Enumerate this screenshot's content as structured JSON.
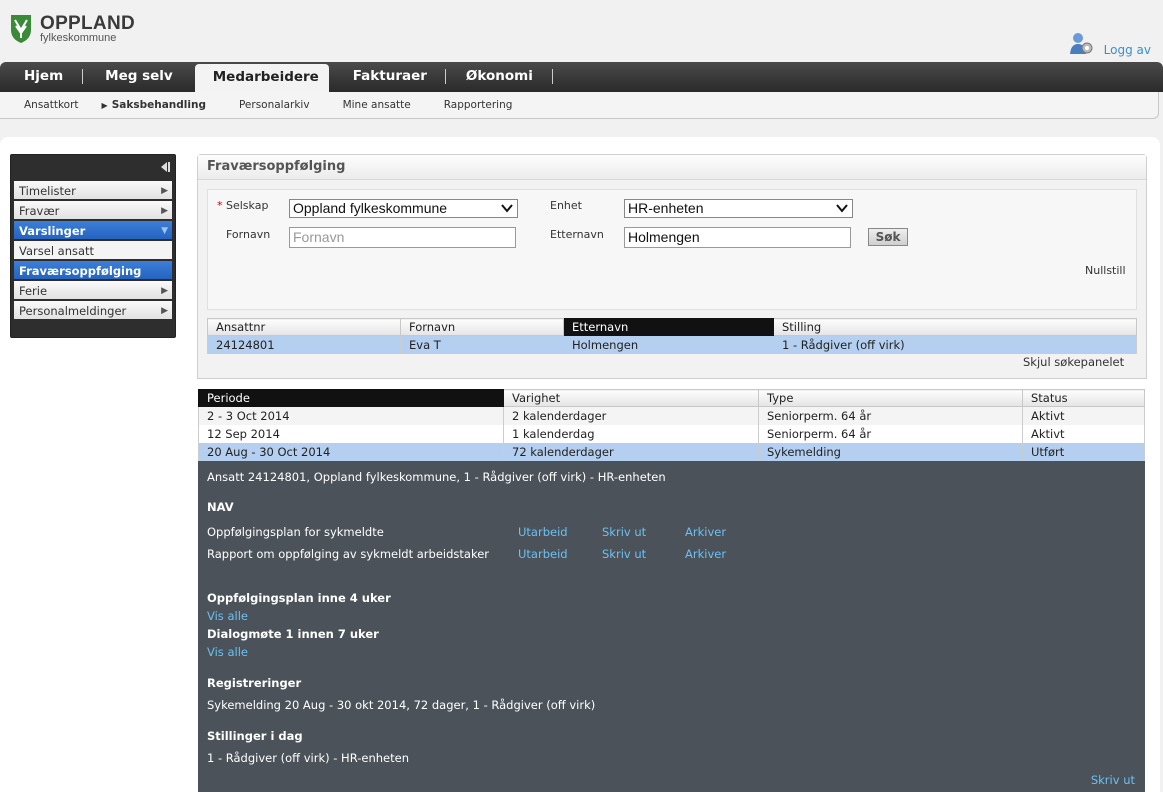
{
  "logo": {
    "line1": "OPPLAND",
    "line2": "fylkeskommune"
  },
  "header": {
    "logout": "Logg av"
  },
  "topnav": [
    "Hjem",
    "Meg selv",
    "Medarbeidere",
    "Fakturaer",
    "Økonomi"
  ],
  "subnav": [
    "Ansattkort",
    "Saksbehandling",
    "Personalarkiv",
    "Mine ansatte",
    "Rapportering"
  ],
  "sidebar": {
    "items": [
      "Timelister",
      "Fravær",
      "Varslinger",
      "Varsel ansatt",
      "Fraværsoppfølging",
      "Ferie",
      "Personalmeldinger"
    ]
  },
  "search": {
    "title": "Fraværsoppfølging",
    "company_label": "Selskap",
    "company_required": "*",
    "company_value": "Oppland fylkeskommune",
    "unit_label": "Enhet",
    "unit_value": "HR-enheten",
    "firstname_label": "Fornavn",
    "firstname_placeholder": "Fornavn",
    "lastname_label": "Etternavn",
    "lastname_value": "Holmengen",
    "search_button": "Søk",
    "reset": "Nullstill",
    "hide_panel": "Skjul søkepanelet"
  },
  "results": {
    "headers": [
      "Ansattnr",
      "Fornavn",
      "Etternavn",
      "Stilling"
    ],
    "rows": [
      [
        "24124801",
        "Eva T",
        "Holmengen",
        "1 - Rådgiver (off virk)"
      ]
    ]
  },
  "absences": {
    "headers": [
      "Periode",
      "Varighet",
      "Type",
      "Status"
    ],
    "rows": [
      [
        "2 - 3 Oct 2014",
        "2 kalenderdager",
        "Seniorperm. 64 år",
        "Aktivt"
      ],
      [
        "12 Sep 2014",
        "1 kalenderdag",
        "Seniorperm. 64 år",
        "Aktivt"
      ],
      [
        "20 Aug - 30 Oct 2014",
        "72 kalenderdager",
        "Sykemelding",
        "Utført"
      ]
    ]
  },
  "detail": {
    "summary": "Ansatt 24124801, Oppland fylkeskommune, 1 - Rådgiver (off virk) - HR-enheten",
    "nav_heading": "NAV",
    "docs": [
      {
        "name": "Oppfølgingsplan for sykmeldte",
        "a1": "Utarbeid",
        "a2": "Skriv ut",
        "a3": "Arkiver"
      },
      {
        "name": "Rapport om oppfølging av sykmeldt arbeidstaker",
        "a1": "Utarbeid",
        "a2": "Skriv ut",
        "a3": "Arkiver"
      }
    ],
    "plan_heading": "Oppfølgingsplan inne 4 uker",
    "plan_link": "Vis alle",
    "dialog_heading": "Dialogmøte 1 innen 7 uker",
    "dialog_link": "Vis alle",
    "reg_heading": "Registreringer",
    "reg_text": "Sykemelding 20 Aug - 30 okt 2014, 72 dager, 1 - Rådgiver (off virk)",
    "pos_heading": "Stillinger i dag",
    "pos_text": "1 - Rådgiver (off virk) - HR-enheten",
    "print": "Skriv ut"
  }
}
